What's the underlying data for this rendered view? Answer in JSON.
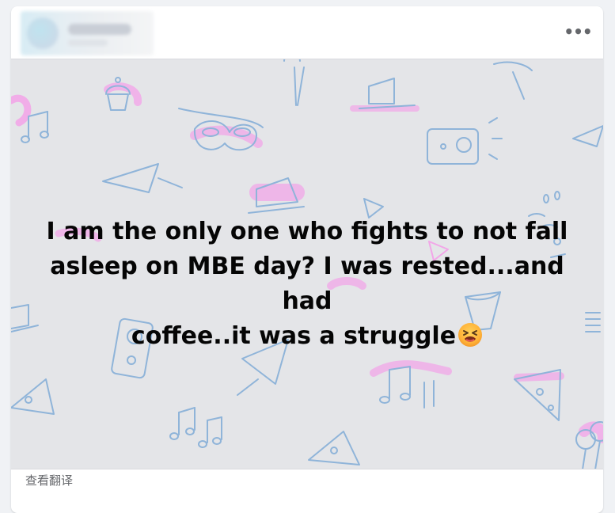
{
  "post": {
    "menu_icon": "more-horizontal-icon",
    "menu_label": "•••",
    "text_line1": "I am the only one who fights to not fall",
    "text_line2": "asleep on MBE day? I was rested...and had",
    "text_line3": "coffee..it was a struggle",
    "emoji": "tired-face-emoji",
    "background_color": "#e4e5e8",
    "doodle_color": "#8fb4d9",
    "highlight_color": "#f2a6e8"
  },
  "footer": {
    "translate_label": "查看翻译"
  }
}
